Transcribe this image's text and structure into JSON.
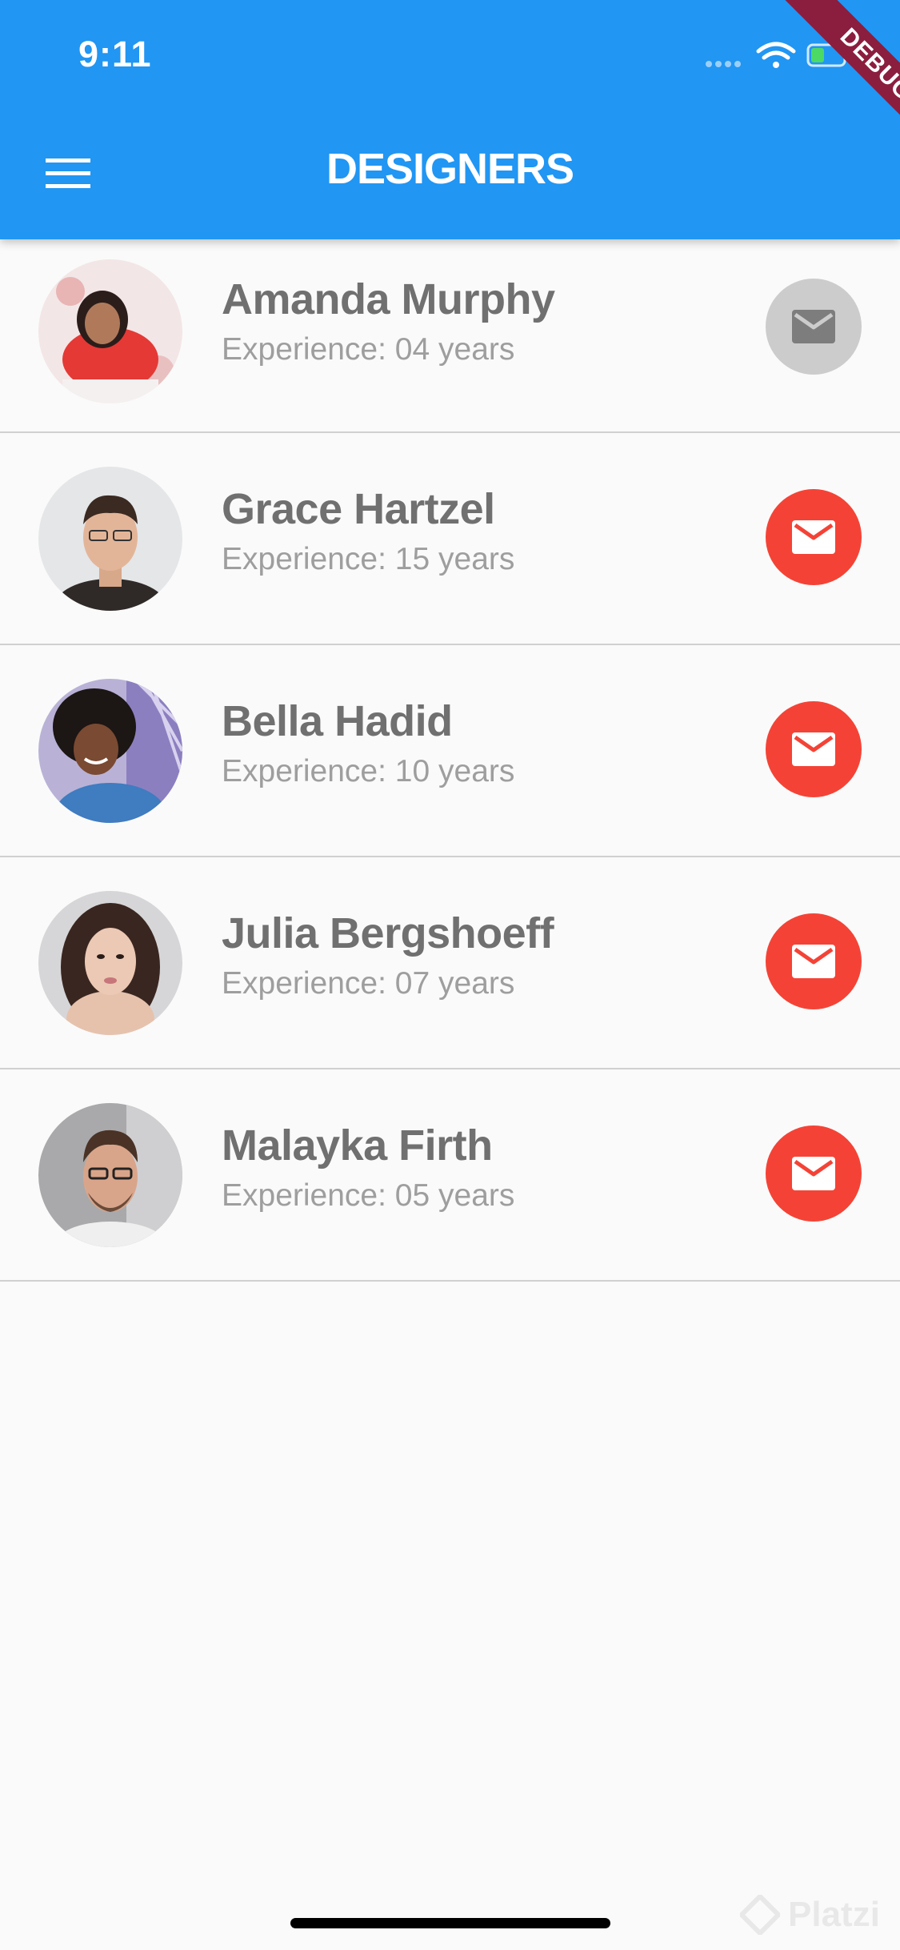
{
  "status_bar": {
    "time": "9:11",
    "signal_icon": "signal-dots-icon",
    "wifi_icon": "wifi-icon",
    "battery_icon": "battery-icon"
  },
  "debug_banner": "DEBUG",
  "app_bar": {
    "title": "DESIGNERS",
    "menu_icon": "menu-icon",
    "color": "#2196f3"
  },
  "designers": [
    {
      "name": "Amanda Murphy",
      "experience": "Experience: 04 years",
      "mail_enabled": false
    },
    {
      "name": "Grace Hartzel",
      "experience": "Experience: 15 years",
      "mail_enabled": true
    },
    {
      "name": "Bella Hadid",
      "experience": "Experience: 10 years",
      "mail_enabled": true
    },
    {
      "name": "Julia Bergshoeff",
      "experience": "Experience: 07 years",
      "mail_enabled": true
    },
    {
      "name": "Malayka Firth",
      "experience": "Experience: 05 years",
      "mail_enabled": true
    }
  ],
  "colors": {
    "mail_active": "#f44336",
    "mail_disabled": "#cccccc",
    "name_text": "#707070",
    "sub_text": "#9e9e9e"
  },
  "watermark": "Platzi"
}
